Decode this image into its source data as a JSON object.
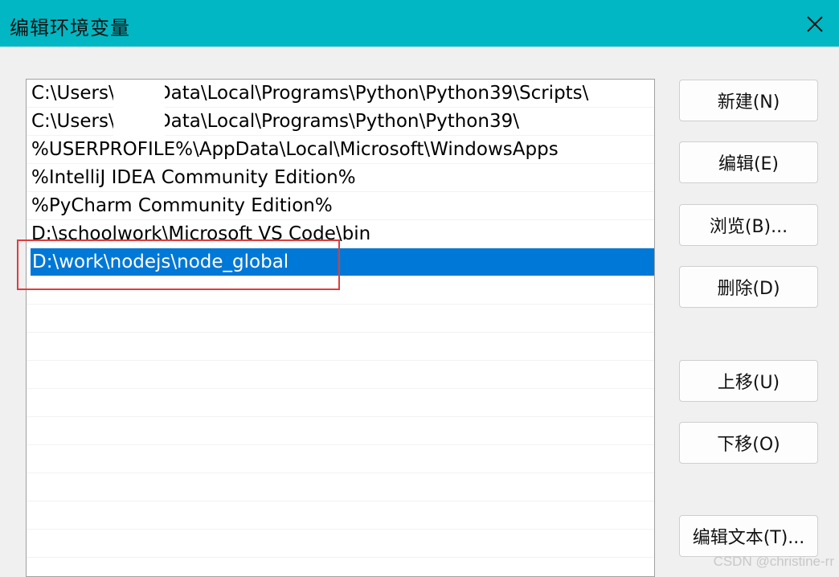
{
  "window": {
    "title": "编辑环境变量"
  },
  "paths": [
    "C:\\Users\\        AppData\\Local\\Programs\\Python\\Python39\\Scripts\\",
    "C:\\Users\\        AppData\\Local\\Programs\\Python\\Python39\\",
    "%USERPROFILE%\\AppData\\Local\\Microsoft\\WindowsApps",
    "%IntelliJ IDEA Community Edition%",
    "%PyCharm Community Edition%",
    "D:\\schoolwork\\Microsoft VS Code\\bin",
    "D:\\work\\nodejs\\node_global"
  ],
  "selected_index": 6,
  "buttons": {
    "new": "新建(N)",
    "edit": "编辑(E)",
    "browse": "浏览(B)...",
    "delete": "删除(D)",
    "move_up": "上移(U)",
    "move_down": "下移(O)",
    "edit_text": "编辑文本(T)..."
  },
  "watermark": "CSDN @christine-rr",
  "colors": {
    "titlebar": "#00b7c3",
    "selection": "#0078d7",
    "highlight": "#e03c3c"
  },
  "icons": {
    "close": "close-icon"
  }
}
